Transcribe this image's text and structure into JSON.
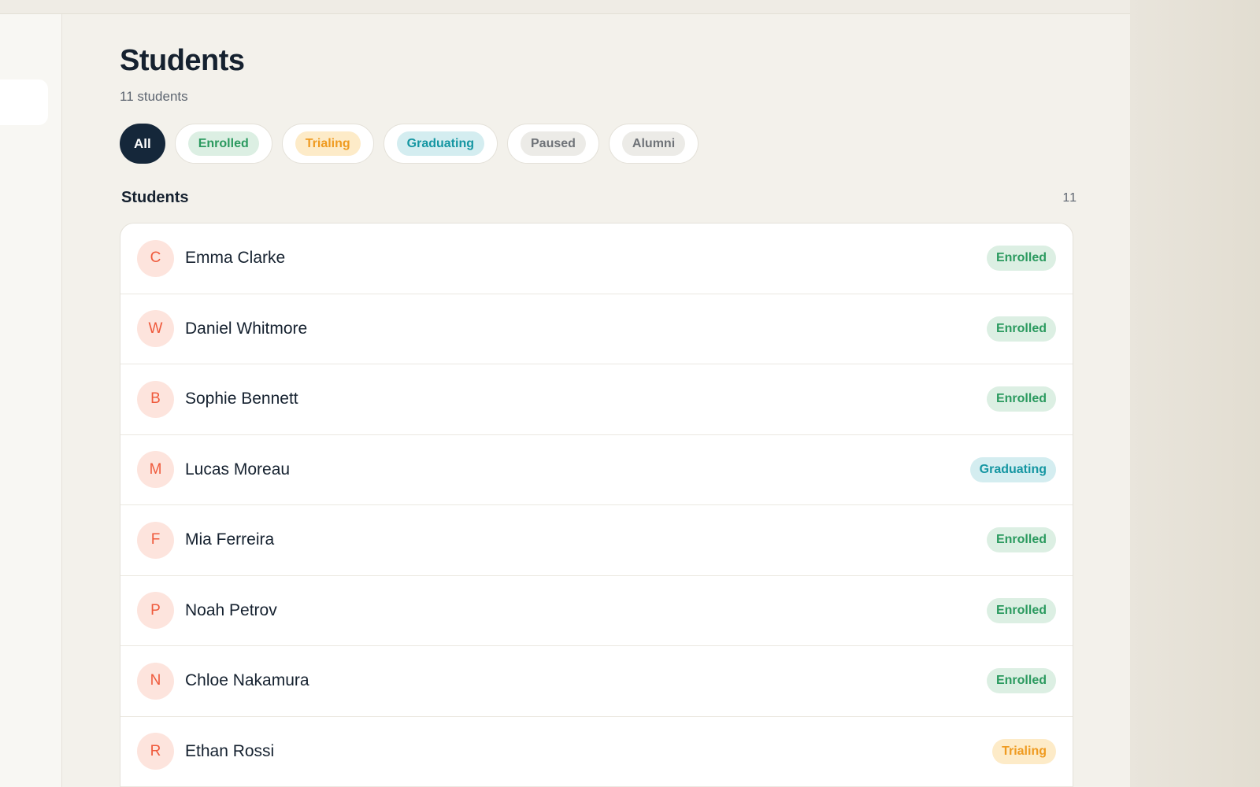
{
  "page": {
    "title": "Students",
    "subtitle": "11 students"
  },
  "filters": [
    {
      "label": "All",
      "kind": "all",
      "selected": true
    },
    {
      "label": "Enrolled",
      "kind": "enrolled",
      "selected": false
    },
    {
      "label": "Trialing",
      "kind": "trialing",
      "selected": false
    },
    {
      "label": "Graduating",
      "kind": "graduating",
      "selected": false
    },
    {
      "label": "Paused",
      "kind": "paused",
      "selected": false
    },
    {
      "label": "Alumni",
      "kind": "alumni",
      "selected": false
    }
  ],
  "section": {
    "title": "Students",
    "count": "11"
  },
  "students": [
    {
      "initial": "C",
      "name": "Emma Clarke",
      "status": "Enrolled",
      "kind": "enrolled"
    },
    {
      "initial": "W",
      "name": "Daniel Whitmore",
      "status": "Enrolled",
      "kind": "enrolled"
    },
    {
      "initial": "B",
      "name": "Sophie Bennett",
      "status": "Enrolled",
      "kind": "enrolled"
    },
    {
      "initial": "M",
      "name": "Lucas Moreau",
      "status": "Graduating",
      "kind": "graduating"
    },
    {
      "initial": "F",
      "name": "Mia Ferreira",
      "status": "Enrolled",
      "kind": "enrolled"
    },
    {
      "initial": "P",
      "name": "Noah Petrov",
      "status": "Enrolled",
      "kind": "enrolled"
    },
    {
      "initial": "N",
      "name": "Chloe Nakamura",
      "status": "Enrolled",
      "kind": "enrolled"
    },
    {
      "initial": "R",
      "name": "Ethan Rossi",
      "status": "Trialing",
      "kind": "trialing"
    }
  ],
  "colors": {
    "enrolled": "#2b9a5f",
    "trialing": "#ef9b21",
    "graduating": "#1596a2",
    "paused": "#6f7378",
    "accent": "#15273a",
    "avatar_text": "#ef5a3c"
  }
}
